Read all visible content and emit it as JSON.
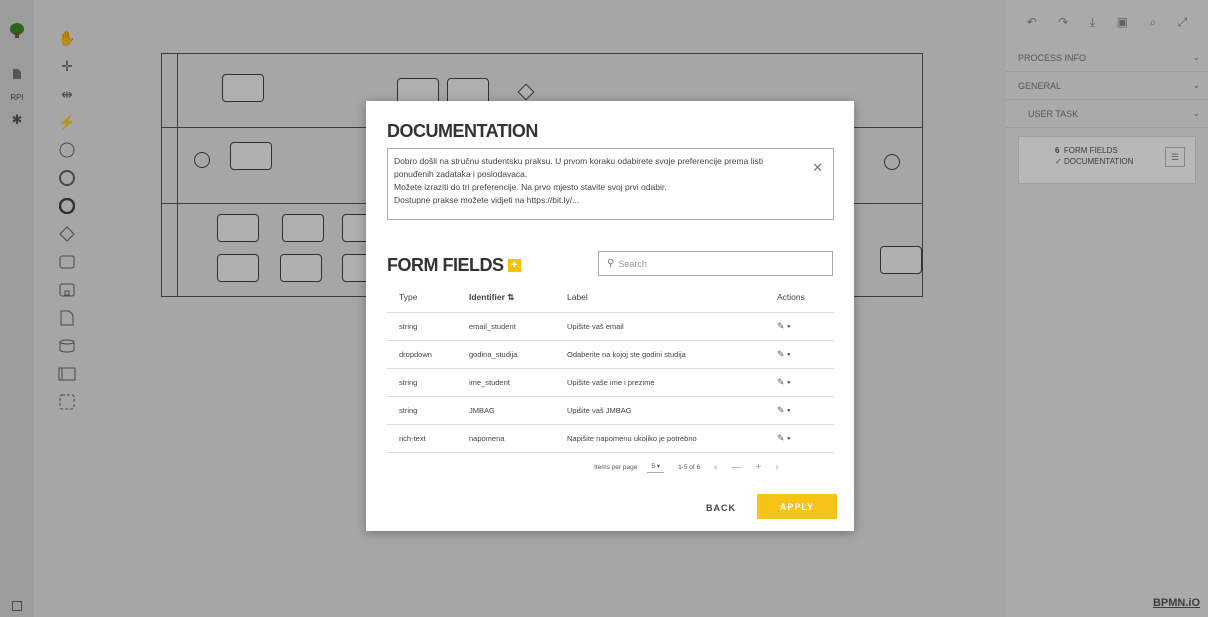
{
  "left_rail": {
    "items": [
      {
        "icon": "tree-logo-icon"
      },
      {
        "icon": "document-icon"
      },
      {
        "label": "RPI"
      },
      {
        "icon": "person-icon"
      }
    ]
  },
  "palette": {
    "tools": [
      "hand-tool-icon",
      "lasso-tool-icon",
      "space-tool-icon",
      "connect-tool-icon",
      "start-event-icon",
      "intermediate-event-icon",
      "end-event-icon",
      "gateway-icon",
      "task-icon",
      "subprocess-icon",
      "data-object-icon",
      "data-store-icon",
      "pool-icon",
      "group-icon"
    ]
  },
  "right_panel": {
    "toolbar": [
      "undo-icon",
      "redo-icon",
      "download-icon",
      "save-icon",
      "search-icon",
      "expand-icon"
    ],
    "sections": [
      {
        "label": "PROCESS INFO"
      },
      {
        "label": "GENERAL"
      },
      {
        "label": "USER TASK"
      }
    ],
    "card": {
      "line1_count": "6",
      "line1_label": "FORM FIELDS",
      "line2_check": "✓",
      "line2_label": "DOCUMENTATION"
    },
    "footer": "BPMN.iO"
  },
  "modal": {
    "doc_title": "DOCUMENTATION",
    "doc_lines": [
      "Dobro došli na stručnu studentsku praksu. U prvom koraku odabirete svoje preferencije prema listi",
      "ponuđenih zadataka i poslodavaca.",
      "Možete izraziti do tri preferencije. Na prvo mjesto stavite svoj prvi odabir.",
      "Dostupne prakse možete vidjeti na https://bit.ly/..."
    ],
    "ff_title": "FORM FIELDS",
    "search_placeholder": "Search",
    "columns": [
      "Type",
      "Identifier",
      "Label",
      "Actions"
    ],
    "rows": [
      {
        "type": "string",
        "id": "email_student",
        "label": "Upišite vaš email"
      },
      {
        "type": "dropdown",
        "id": "godina_studija",
        "label": "Odaberite na kojoj ste godini studija"
      },
      {
        "type": "string",
        "id": "ime_student",
        "label": "Upišite vaše ime i prezime"
      },
      {
        "type": "string",
        "id": "JMBAG",
        "label": "Upišite vaš JMBAG"
      },
      {
        "type": "rich-text",
        "id": "napomena",
        "label": "Napišite napomenu ukoliko je potrebno"
      }
    ],
    "pager": {
      "label": "Items per page",
      "per_page": "5",
      "range": "1-5 of 6"
    },
    "back_label": "BACK",
    "apply_label": "APPLY"
  }
}
